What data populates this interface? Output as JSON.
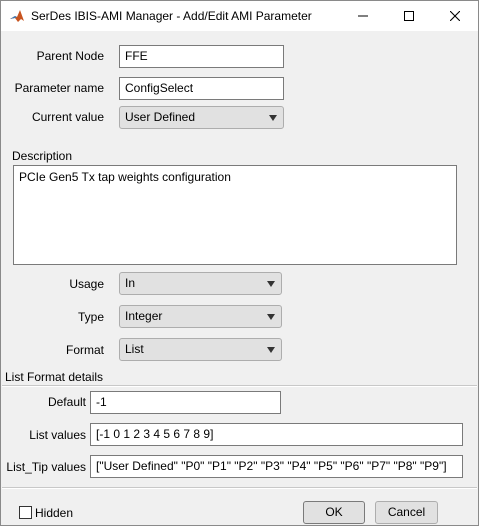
{
  "window": {
    "title": "SerDes IBIS-AMI Manager - Add/Edit AMI Parameter",
    "icons": {
      "app": "matlab-icon",
      "minimize": "minimize-icon",
      "maximize": "maximize-icon",
      "close": "close-icon"
    }
  },
  "form": {
    "parent_node": {
      "label": "Parent Node",
      "value": "FFE"
    },
    "parameter_name": {
      "label": "Parameter name",
      "value": "ConfigSelect"
    },
    "current_value": {
      "label": "Current value",
      "value": "User Defined"
    },
    "description": {
      "label": "Description",
      "value": "PCIe Gen5 Tx tap weights configuration"
    },
    "usage": {
      "label": "Usage",
      "value": "In"
    },
    "type": {
      "label": "Type",
      "value": "Integer"
    },
    "format": {
      "label": "Format",
      "value": "List"
    }
  },
  "list_format": {
    "heading": "List Format details",
    "default": {
      "label": "Default",
      "value": "-1"
    },
    "list_values": {
      "label": "List values",
      "value": "[-1 0 1 2 3 4 5 6 7 8 9]"
    },
    "list_tip_values": {
      "label": "List_Tip values",
      "value": "[\"User Defined\" \"P0\" \"P1\" \"P2\" \"P3\" \"P4\" \"P5\" \"P6\" \"P7\" \"P8\" \"P9\"]"
    }
  },
  "footer": {
    "hidden_label": "Hidden",
    "hidden_checked": false,
    "ok_label": "OK",
    "cancel_label": "Cancel"
  },
  "colors": {
    "dialog_bg": "#f0f0f0",
    "titlebar_bg": "#ffffff",
    "button_bg": "#e1e1e1"
  }
}
